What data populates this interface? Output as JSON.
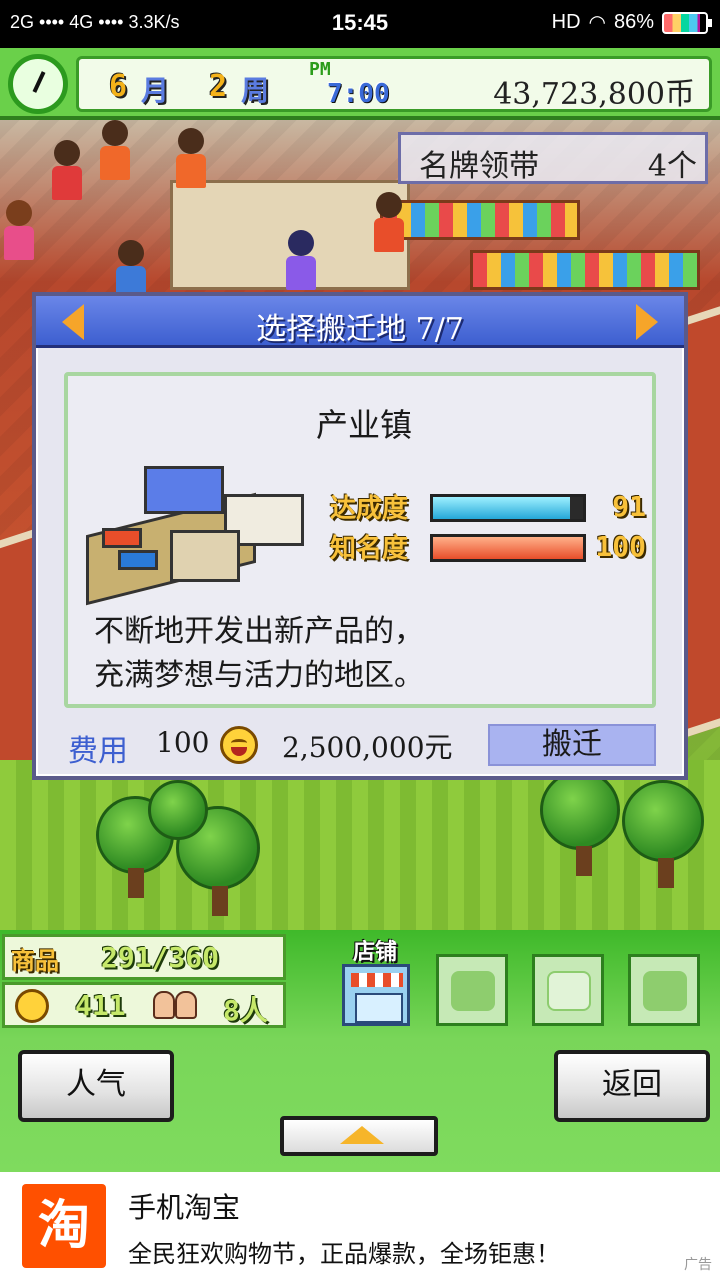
{
  "status_bar": {
    "left": "2G •••• 4G •••• 3.3K/s",
    "time": "15:45",
    "hd": "HD",
    "battery": "86%"
  },
  "hud": {
    "month": "6",
    "month_unit": "月",
    "week": "2",
    "week_unit": "周",
    "ampm": "PM",
    "clock_time": "7:00",
    "money": "43,723,800币"
  },
  "item_panel": {
    "name": "名牌领带",
    "count": "4个"
  },
  "dialog": {
    "title": "选择搬迁地 7/7",
    "place_name": "产业镇",
    "stats": [
      {
        "label": "达成度",
        "value": "91",
        "fill": 0.91,
        "color": "#25a7d8"
      },
      {
        "label": "知名度",
        "value": "100",
        "fill": 1.0,
        "color": "#e84e2a"
      }
    ],
    "description_line1": "不断地开发出新产品的，",
    "description_line2": "充满梦想与活力的地区。",
    "cost_label": "费用",
    "cost_points": "100",
    "cost_money": "2,500,000元",
    "move_button": "搬迁"
  },
  "bottom_bar": {
    "goods_label": "商品",
    "goods_value": "291/360",
    "popularity": "411",
    "staff": "8人",
    "shop_tab": "店铺",
    "popularity_button": "人气",
    "back_button": "返回"
  },
  "ad": {
    "logo": "淘",
    "title": "手机淘宝",
    "description": "全民狂欢购物节，正品爆款，全场钜惠！",
    "tag": "广告"
  },
  "colors": {
    "hud_green": "#6ad04a",
    "dialog_title_blue": "#3d5fd0",
    "move_button_bg": "#a9b3f0",
    "ad_brand": "#ff5000"
  }
}
